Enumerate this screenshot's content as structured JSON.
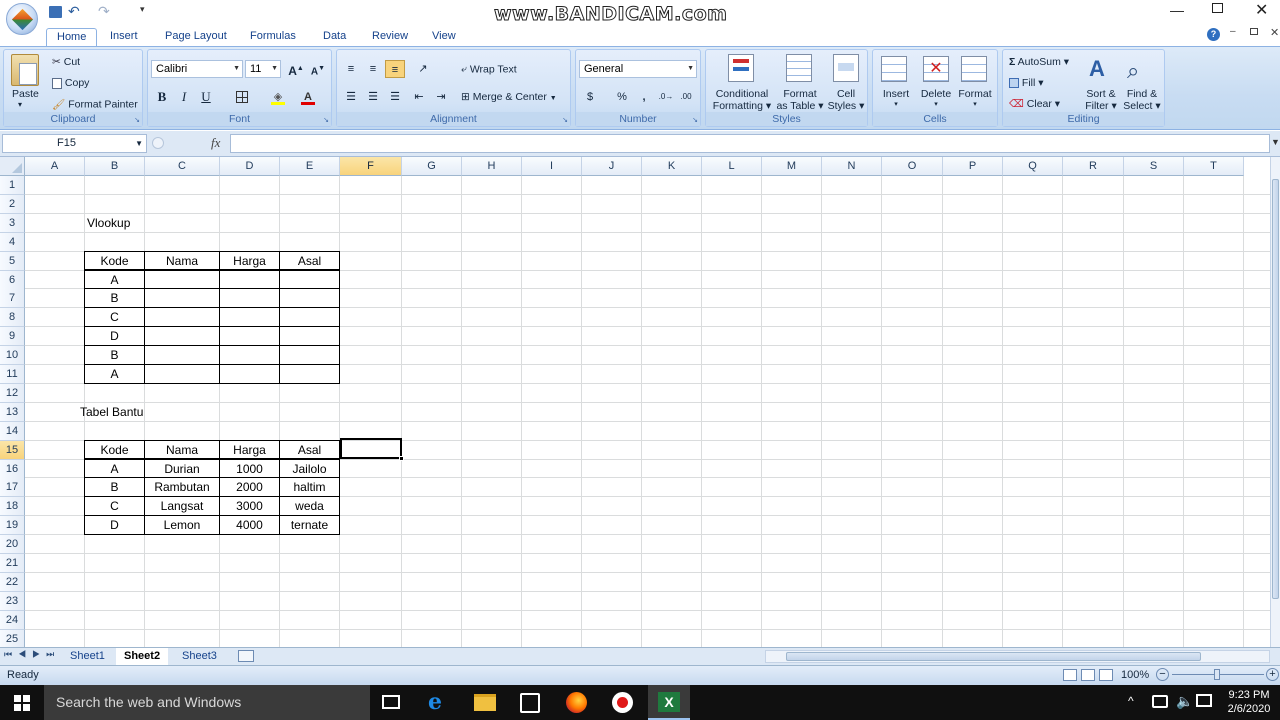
{
  "watermark": "www.BANDICAM.com",
  "ribbon_tabs": [
    "Home",
    "Insert",
    "Page Layout",
    "Formulas",
    "Data",
    "Review",
    "View"
  ],
  "clipboard": {
    "paste": "Paste",
    "cut": "Cut",
    "copy": "Copy",
    "format_painter": "Format Painter",
    "label": "Clipboard"
  },
  "font": {
    "name": "Calibri",
    "size": "11",
    "bold": "B",
    "italic": "I",
    "underline": "U",
    "label": "Font"
  },
  "alignment": {
    "wrap_text": "Wrap Text",
    "merge_center": "Merge & Center",
    "label": "Alignment"
  },
  "number": {
    "format": "General",
    "currency": "$",
    "percent": "%",
    "comma": ",",
    "label": "Number"
  },
  "styles": {
    "conditional_1": "Conditional",
    "conditional_2": "Formatting",
    "format_table_1": "Format",
    "format_table_2": "as Table",
    "cell_styles_1": "Cell",
    "cell_styles_2": "Styles",
    "label": "Styles"
  },
  "cells": {
    "insert": "Insert",
    "delete": "Delete",
    "format": "Format",
    "label": "Cells"
  },
  "editing": {
    "autosum": "AutoSum",
    "fill": "Fill",
    "clear": "Clear",
    "sort_1": "Sort &",
    "sort_2": "Filter",
    "find_1": "Find &",
    "find_2": "Select",
    "label": "Editing"
  },
  "formula_bar": {
    "name_box": "F15",
    "fx": "fx",
    "value": ""
  },
  "columns": [
    "A",
    "B",
    "C",
    "D",
    "E",
    "F",
    "G",
    "H",
    "I",
    "J",
    "K",
    "L",
    "M",
    "N",
    "O",
    "P",
    "Q",
    "R",
    "S",
    "T"
  ],
  "rows": [
    "1",
    "2",
    "3",
    "4",
    "5",
    "6",
    "7",
    "8",
    "9",
    "10",
    "11",
    "12",
    "13",
    "14",
    "15",
    "16",
    "17",
    "18",
    "19",
    "20",
    "21",
    "22",
    "23",
    "24",
    "25"
  ],
  "selected_cell": "F15",
  "labels": {
    "vlookup": "Vlookup",
    "tabel_bantu": "Tabel Bantu"
  },
  "table1": {
    "headers": [
      "Kode",
      "Nama",
      "Harga",
      "Asal"
    ],
    "rows": [
      [
        "A",
        "",
        "",
        ""
      ],
      [
        "B",
        "",
        "",
        ""
      ],
      [
        "C",
        "",
        "",
        ""
      ],
      [
        "D",
        "",
        "",
        ""
      ],
      [
        "B",
        "",
        "",
        ""
      ],
      [
        "A",
        "",
        "",
        ""
      ]
    ]
  },
  "table2": {
    "headers": [
      "Kode",
      "Nama",
      "Harga",
      "Asal"
    ],
    "rows": [
      [
        "A",
        "Durian",
        "1000",
        "Jailolo"
      ],
      [
        "B",
        "Rambutan",
        "2000",
        "haltim"
      ],
      [
        "C",
        "Langsat",
        "3000",
        "weda"
      ],
      [
        "D",
        "Lemon",
        "4000",
        "ternate"
      ]
    ]
  },
  "sheets": [
    "Sheet1",
    "Sheet2",
    "Sheet3"
  ],
  "active_sheet": "Sheet2",
  "status": {
    "ready": "Ready",
    "zoom": "100%"
  },
  "taskbar": {
    "search_placeholder": "Search the web and Windows",
    "time": "9:23 PM",
    "date": "2/6/2020"
  },
  "accent": "#f8d37c"
}
